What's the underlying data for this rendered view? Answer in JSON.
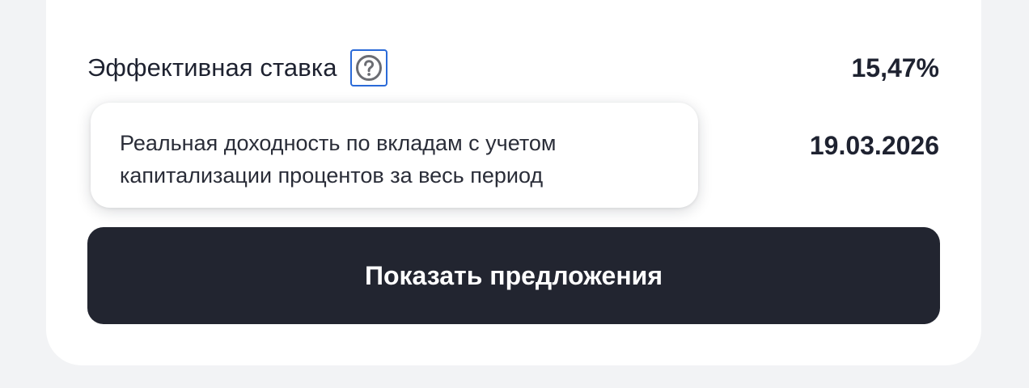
{
  "rows": {
    "effective_rate": {
      "label": "Эффективная ставка",
      "value": "15,47%",
      "help_icon": "question-circle-icon"
    },
    "end_date": {
      "label_visible_fragment": "",
      "value": "19.03.2026"
    }
  },
  "tooltip": {
    "line1": "Реальная доходность по вкладам с учетом",
    "line2": "капитализации процентов за весь период"
  },
  "cta": {
    "label": "Показать предложения"
  },
  "colors": {
    "page_bg": "#f2f3f5",
    "card_bg": "#ffffff",
    "text": "#1e2230",
    "button_bg": "#222530",
    "button_text": "#ffffff",
    "focus_ring": "#2a6ad8"
  }
}
